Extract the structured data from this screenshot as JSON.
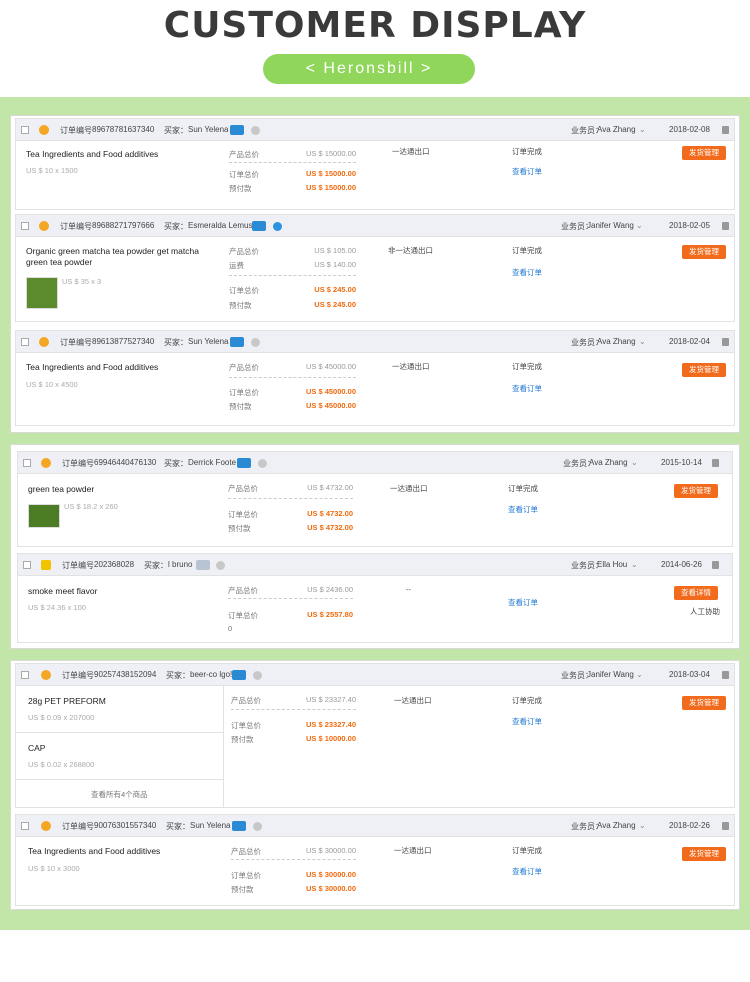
{
  "header": {
    "title": "CUSTOMER DISPLAY",
    "brand": "< Heronsbill >"
  },
  "labels": {
    "order_no": "订单编号",
    "buyer": "买家：",
    "salesman": "业务员：",
    "product_total": "产品总价",
    "order_total": "订单总价",
    "prepay": "预付款",
    "shipping": "运费",
    "order_done": "订单完成",
    "view_order": "查看订单",
    "ship_manage": "发货管理",
    "view_detail": "查看详情",
    "manual": "人工协助",
    "view_all": "查看所有4个商品"
  },
  "orders": [
    {
      "order_no": "89678781637340",
      "buyer": "Sun Yelena",
      "salesman": "Ava Zhang",
      "date": "2018-02-08",
      "product": "Tea Ingredients and Food additives",
      "meta": "US $ 10 x 1500",
      "product_total": "US $ 15000.00",
      "order_total": "US $ 15000.00",
      "prepay": "US $ 15000.00",
      "ship": "一达通出口"
    },
    {
      "order_no": "89688271797666",
      "buyer": "Esmeralda Lemus",
      "salesman": "Janifer Wang",
      "date": "2018-02-05",
      "product": "Organic green matcha tea powder get matcha green tea powder",
      "meta": "US $ 35 x 3",
      "product_total": "US $ 105.00",
      "shipping": "US $ 140.00",
      "order_total": "US $ 245.00",
      "prepay": "US $ 245.00",
      "ship": "非一达通出口"
    },
    {
      "order_no": "89613877527340",
      "buyer": "Sun Yelena",
      "salesman": "Ava Zhang",
      "date": "2018-02-04",
      "product": "Tea Ingredients and Food additives",
      "meta": "US $ 10 x 4500",
      "product_total": "US $ 45000.00",
      "order_total": "US $ 45000.00",
      "prepay": "US $ 45000.00",
      "ship": "一达通出口"
    },
    {
      "order_no": "69946440476130",
      "buyer": "Derrick Foote",
      "salesman": "Ava Zhang",
      "date": "2015-10-14",
      "product": "green tea powder",
      "meta": "US $ 18.2 x 260",
      "product_total": "US $ 4732.00",
      "order_total": "US $ 4732.00",
      "prepay": "US $ 4732.00",
      "ship": "一达通出口"
    },
    {
      "order_no": "202368028",
      "buyer": "l bruno",
      "salesman": "Ella Hou",
      "date": "2014-06-26",
      "product": "smoke meet flavor",
      "meta": "US $ 24.36 x 100",
      "product_total": "US $ 2436.00",
      "order_total": "US $ 2557.80",
      "extra": "0",
      "ship": "--"
    },
    {
      "order_no": "90257438152094",
      "buyer": "beer-co lgo!",
      "salesman": "Janifer Wang",
      "date": "2018-03-04",
      "product": "28g PET PREFORM",
      "meta": "US $ 0.09 x 207000",
      "product2": "CAP",
      "meta2": "US $ 0.02 x 268800",
      "product_total": "US $ 23327.40",
      "order_total": "US $ 23327.40",
      "prepay": "US $ 10000.00",
      "ship": "一达通出口"
    },
    {
      "order_no": "90076301557340",
      "buyer": "Sun Yelena",
      "salesman": "Ava Zhang",
      "date": "2018-02-26",
      "product": "Tea Ingredients and Food additives",
      "meta": "US $ 10 x 3000",
      "product_total": "US $ 30000.00",
      "order_total": "US $ 30000.00",
      "prepay": "US $ 30000.00",
      "ship": "一达通出口"
    }
  ]
}
